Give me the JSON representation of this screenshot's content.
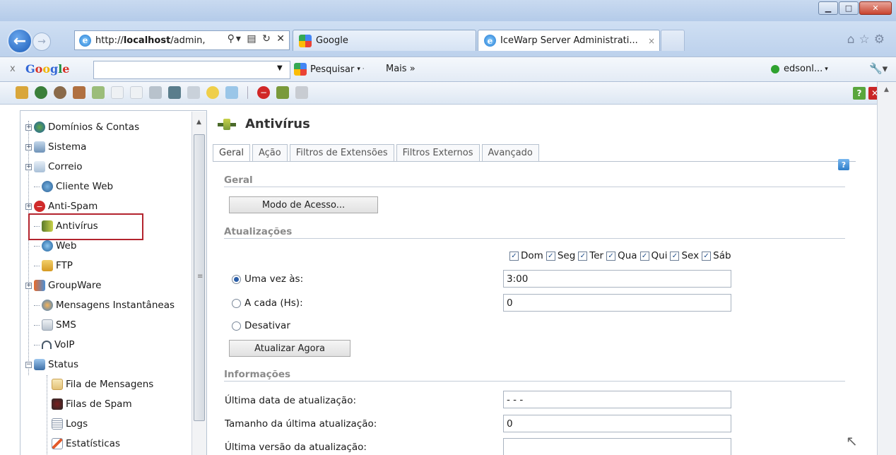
{
  "browser": {
    "address": {
      "prefix": "http://",
      "host": "localhost",
      "path": "/admin,"
    },
    "tabs": [
      {
        "label": "Google"
      },
      {
        "label": "IceWarp Server Administrati...",
        "close": "×"
      }
    ]
  },
  "google_toolbar": {
    "close": "x",
    "logo": "Google",
    "search_button": "Pesquisar",
    "more": "Mais »",
    "user": "edsonl..."
  },
  "tree": {
    "items": [
      {
        "label": "Domínios & Contas"
      },
      {
        "label": "Sistema"
      },
      {
        "label": "Correio"
      },
      {
        "label": "Cliente Web"
      },
      {
        "label": "Anti-Spam"
      },
      {
        "label": "Antivírus"
      },
      {
        "label": "Web"
      },
      {
        "label": "FTP"
      },
      {
        "label": "GroupWare"
      },
      {
        "label": "Mensagens Instantâneas"
      },
      {
        "label": "SMS"
      },
      {
        "label": "VoIP"
      },
      {
        "label": "Status"
      },
      {
        "label": "Fila de Mensagens"
      },
      {
        "label": "Filas de Spam"
      },
      {
        "label": "Logs"
      },
      {
        "label": "Estatísticas"
      }
    ]
  },
  "main": {
    "title": "Antivírus",
    "tabs": [
      {
        "label": "Geral"
      },
      {
        "label": "Ação"
      },
      {
        "label": "Filtros de Extensões"
      },
      {
        "label": "Filtros Externos"
      },
      {
        "label": "Avançado"
      }
    ],
    "section_geral": "Geral",
    "access_button": "Modo de Acesso...",
    "section_updates": "Atualizações",
    "days": [
      {
        "label": "Dom",
        "checked": true
      },
      {
        "label": "Seg",
        "checked": true
      },
      {
        "label": "Ter",
        "checked": true
      },
      {
        "label": "Qua",
        "checked": true
      },
      {
        "label": "Qui",
        "checked": true
      },
      {
        "label": "Sex",
        "checked": true
      },
      {
        "label": "Sáb",
        "checked": true
      }
    ],
    "radio_once": {
      "label": "Uma vez às:",
      "value": "3:00",
      "selected": true
    },
    "radio_every": {
      "label": "A cada (Hs):",
      "value": "0",
      "selected": false
    },
    "radio_disable": {
      "label": "Desativar",
      "selected": false
    },
    "update_button": "Atualizar Agora",
    "section_info": "Informações",
    "info": [
      {
        "label": "Última data de atualização:",
        "value": "- - -"
      },
      {
        "label": "Tamanho da última atualização:",
        "value": "0"
      },
      {
        "label": "Última versão da atualização:",
        "value": ""
      }
    ]
  }
}
